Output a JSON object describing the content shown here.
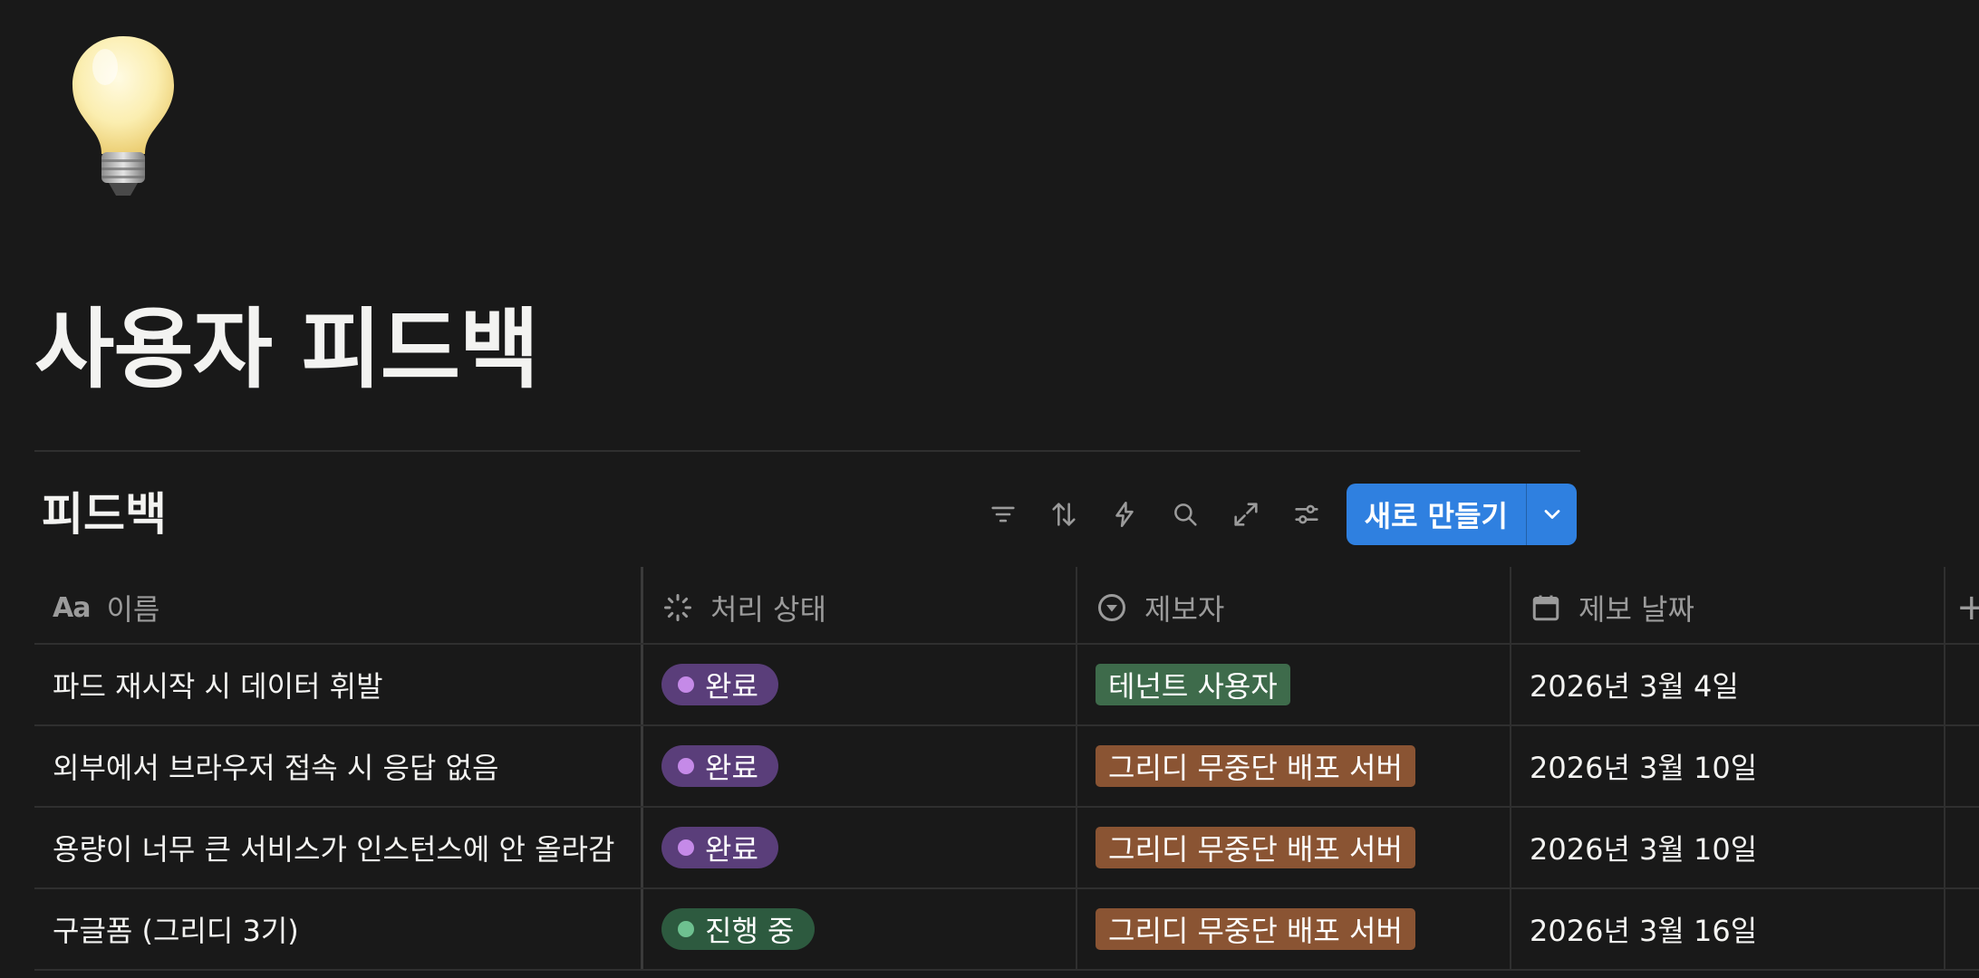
{
  "page": {
    "icon": "lightbulb-icon",
    "title": "사용자 피드백"
  },
  "database": {
    "title": "피드백",
    "toolbar": {
      "icons": [
        "filter-icon",
        "sort-icon",
        "automation-icon",
        "search-icon",
        "expand-icon",
        "settings-icon"
      ],
      "new_label": "새로 만들기"
    },
    "columns": [
      {
        "label": "이름",
        "icon": "text-property-icon"
      },
      {
        "label": "처리 상태",
        "icon": "status-property-icon"
      },
      {
        "label": "제보자",
        "icon": "select-property-icon"
      },
      {
        "label": "제보 날짜",
        "icon": "calendar-property-icon"
      }
    ],
    "rows": [
      {
        "name": "파드 재시작 시 데이터 휘발",
        "status": "완료",
        "reporter": "테넌트 사용자",
        "date": "2026년 3월 4일"
      },
      {
        "name": "외부에서 브라우저 접속 시 응답 없음",
        "status": "완료",
        "reporter": "그리디 무중단 배포 서버",
        "date": "2026년 3월 10일"
      },
      {
        "name": "용량이 너무 큰 서비스가 인스턴스에 안 올라감",
        "status": "완료",
        "reporter": "그리디 무중단 배포 서버",
        "date": "2026년 3월 10일"
      },
      {
        "name": "구글폼 (그리디 3기)",
        "status": "진행 중",
        "reporter": "그리디 무중단 배포 서버",
        "date": "2026년 3월 16일"
      }
    ]
  },
  "colors": {
    "background": "#191919",
    "primary_button": "#2f80e0",
    "status_done": "#5a3e7a",
    "status_in_progress": "#2d5a3f",
    "reporter_tenant": "#3e6b4b",
    "reporter_greedy": "#8a5433"
  }
}
